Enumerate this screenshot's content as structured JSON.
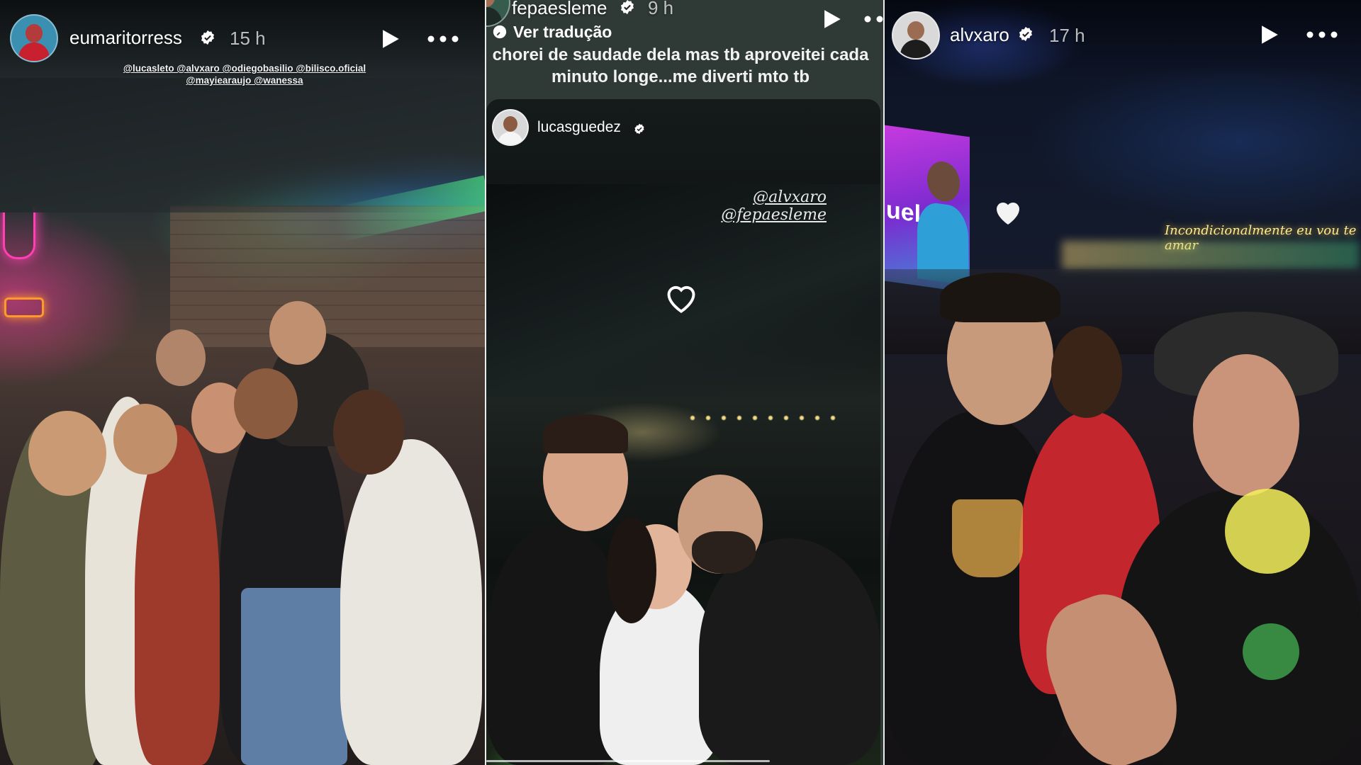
{
  "stories": [
    {
      "username": "eumaritorress",
      "time": "15 h",
      "mentions_line1": "@lucasleto @alvxaro @odiegobasilio @bilisco.oficial",
      "mentions_line2": "@mayiearaujo @wanessa",
      "neon_sign": "",
      "bar_sign": ""
    },
    {
      "username": "fepaesleme",
      "time": "9 h",
      "translate_label": "Ver tradução",
      "caption": "chorei de saudade dela mas tb aproveitei cada minuto longe...me diverti mto tb",
      "repost_username": "lucasguedez",
      "sticker_line1": "@alvxaro",
      "sticker_line2": "@fepaesleme"
    },
    {
      "username": "alvxaro",
      "time": "17 h",
      "neon_text": "Incondicionalmente eu vou te amar",
      "screen_text": "uel"
    }
  ],
  "icons": {
    "verified": "verified-badge-icon",
    "play": "play-icon",
    "more": "more-options-icon",
    "translate": "translate-icon",
    "heart": "heart-icon"
  },
  "colors": {
    "divider": "#e9eeec",
    "verified_fill": "#ffffff",
    "panel2_bg": "#2f3a37"
  }
}
